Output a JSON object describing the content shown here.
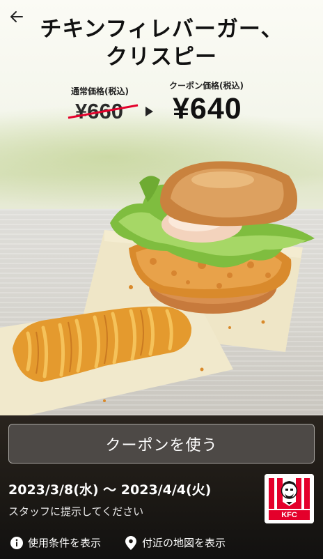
{
  "header": {
    "title_line1": "チキンフィレバーガー、",
    "title_line2": "クリスピー"
  },
  "price": {
    "regular_label": "通常価格(税込)",
    "regular_value": "¥660",
    "coupon_label": "クーポン価格(税込)",
    "coupon_value": "¥640"
  },
  "coupon": {
    "use_button_label": "クーポンを使う",
    "period": "2023/3/8(水) 〜 2023/4/4(火)",
    "instruction": "スタッフに提示してください"
  },
  "brand": {
    "logo_text": "KFC",
    "red": "#e4002b"
  },
  "links": {
    "terms_label": "使用条件を表示",
    "map_label": "付近の地図を表示"
  },
  "icons": [
    "back-arrow-icon",
    "info-icon",
    "map-pin-icon"
  ]
}
